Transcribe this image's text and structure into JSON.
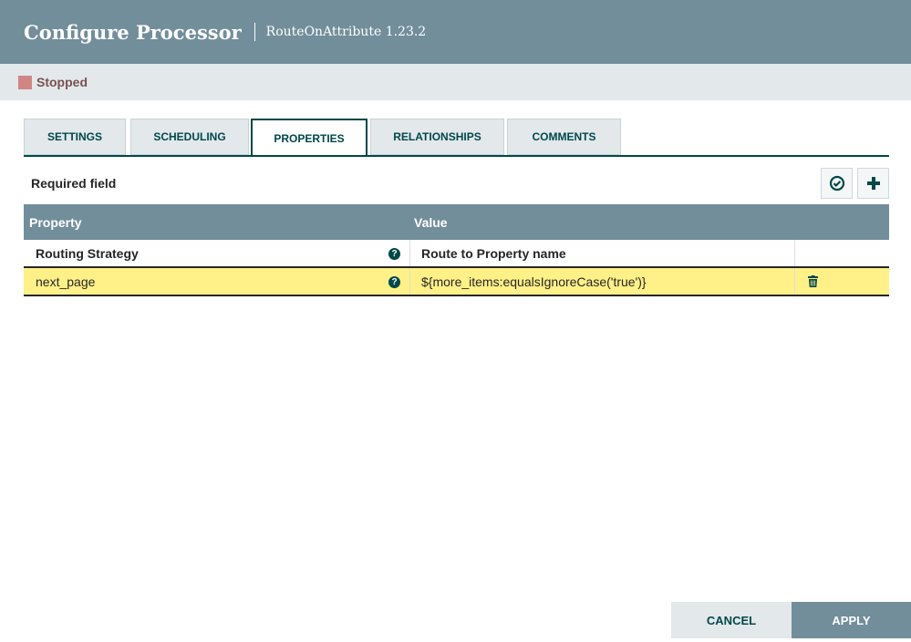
{
  "header": {
    "title": "Configure Processor",
    "subtitle": "RouteOnAttribute 1.23.2"
  },
  "status": {
    "label": "Stopped",
    "color": "#d18686"
  },
  "tabs": [
    {
      "label": "SETTINGS"
    },
    {
      "label": "SCHEDULING"
    },
    {
      "label": "PROPERTIES",
      "active": true
    },
    {
      "label": "RELATIONSHIPS"
    },
    {
      "label": "COMMENTS"
    }
  ],
  "properties": {
    "required_label": "Required field",
    "verify_icon": "check-circle-icon",
    "add_icon": "plus-icon",
    "columns": {
      "property": "Property",
      "value": "Value"
    },
    "rows": [
      {
        "property": "Routing Strategy",
        "value": "Route to Property name",
        "required": true
      },
      {
        "property": "next_page",
        "value": "${more_items:equalsIgnoreCase('true')}",
        "required": false
      }
    ]
  },
  "footer": {
    "cancel": "CANCEL",
    "apply": "APPLY"
  }
}
